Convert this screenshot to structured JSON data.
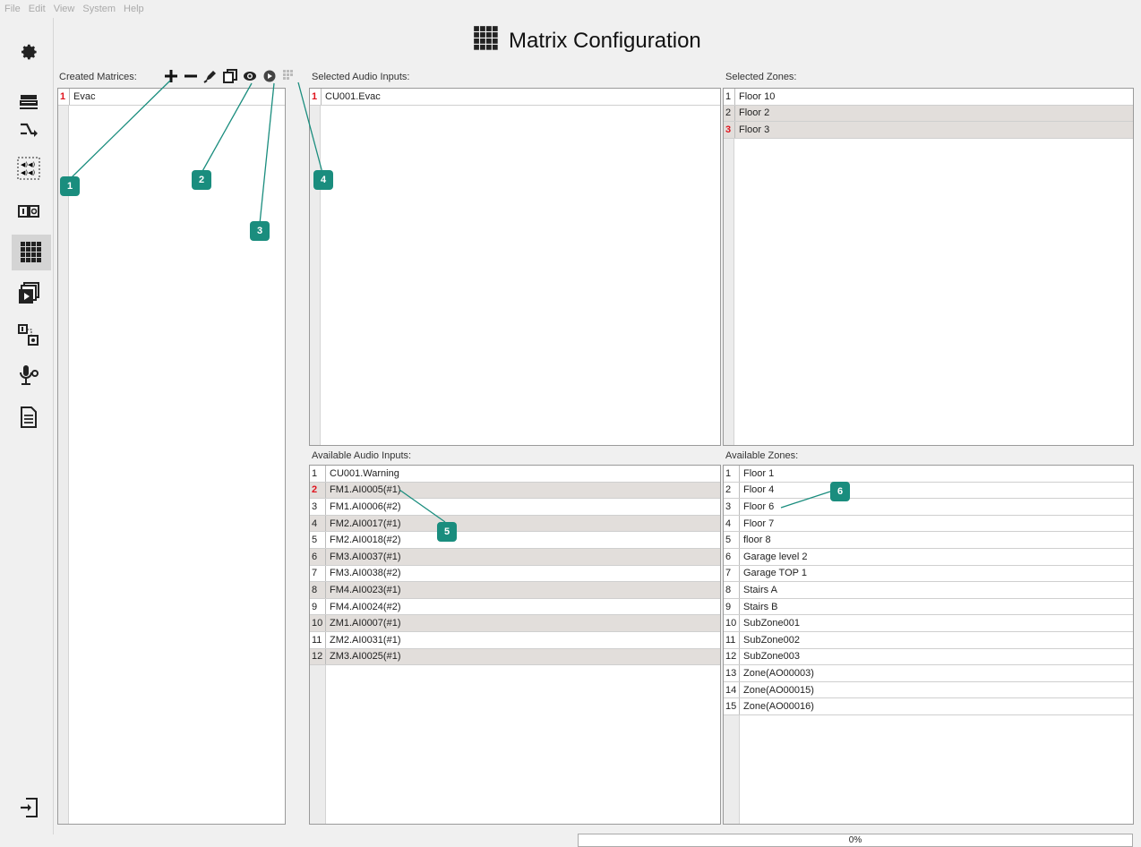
{
  "menu": [
    "File",
    "Edit",
    "View",
    "System",
    "Help"
  ],
  "rail": [
    {
      "name": "settings-gear-icon",
      "glyph": "✿"
    },
    {
      "name": "server-rack-icon"
    },
    {
      "name": "routing-arrow-icon"
    },
    {
      "name": "speaker-group-icon"
    },
    {
      "name": "io-icon"
    },
    {
      "name": "matrix-grid-icon"
    },
    {
      "name": "message-playback-icon"
    },
    {
      "name": "io-link-icon"
    },
    {
      "name": "call-station-icon"
    },
    {
      "name": "document-icon"
    },
    {
      "name": "logout-icon"
    }
  ],
  "title": "Matrix Configuration",
  "created_matrices": {
    "label": "Created Matrices:",
    "items": [
      {
        "n": "1",
        "text": "Evac",
        "red": true
      }
    ]
  },
  "toolbar": {
    "add": "+",
    "remove": "−",
    "edit": "✎",
    "copy": "⎘",
    "view": "◉",
    "play": "▶",
    "matrix": "⠿"
  },
  "selected_audio_inputs": {
    "label": "Selected Audio Inputs:",
    "items": [
      {
        "n": "1",
        "text": "CU001.Evac",
        "red": true
      }
    ]
  },
  "selected_zones": {
    "label": "Selected Zones:",
    "items": [
      {
        "n": "1",
        "text": "Floor 10",
        "red": false,
        "alt": false
      },
      {
        "n": "2",
        "text": "Floor 2",
        "red": false,
        "alt": true
      },
      {
        "n": "3",
        "text": "Floor 3",
        "red": true,
        "alt": true
      }
    ]
  },
  "available_audio_inputs": {
    "label": "Available Audio Inputs:",
    "items": [
      {
        "n": "1",
        "text": "CU001.Warning",
        "red": false,
        "alt": false
      },
      {
        "n": "2",
        "text": "FM1.AI0005(#1)",
        "red": true,
        "alt": true
      },
      {
        "n": "3",
        "text": "FM1.AI0006(#2)",
        "red": false,
        "alt": false
      },
      {
        "n": "4",
        "text": "FM2.AI0017(#1)",
        "red": false,
        "alt": true
      },
      {
        "n": "5",
        "text": "FM2.AI0018(#2)",
        "red": false,
        "alt": false
      },
      {
        "n": "6",
        "text": "FM3.AI0037(#1)",
        "red": false,
        "alt": true
      },
      {
        "n": "7",
        "text": "FM3.AI0038(#2)",
        "red": false,
        "alt": false
      },
      {
        "n": "8",
        "text": "FM4.AI0023(#1)",
        "red": false,
        "alt": true
      },
      {
        "n": "9",
        "text": "FM4.AI0024(#2)",
        "red": false,
        "alt": false
      },
      {
        "n": "10",
        "text": "ZM1.AI0007(#1)",
        "red": false,
        "alt": true
      },
      {
        "n": "11",
        "text": "ZM2.AI0031(#1)",
        "red": false,
        "alt": false
      },
      {
        "n": "12",
        "text": "ZM3.AI0025(#1)",
        "red": false,
        "alt": true
      }
    ]
  },
  "available_zones": {
    "label": "Available Zones:",
    "items": [
      {
        "n": "1",
        "text": "Floor 1"
      },
      {
        "n": "2",
        "text": "Floor 4"
      },
      {
        "n": "3",
        "text": "Floor 6"
      },
      {
        "n": "4",
        "text": "Floor 7"
      },
      {
        "n": "5",
        "text": "floor 8"
      },
      {
        "n": "6",
        "text": "Garage level 2"
      },
      {
        "n": "7",
        "text": "Garage TOP 1"
      },
      {
        "n": "8",
        "text": "Stairs A"
      },
      {
        "n": "9",
        "text": "Stairs B"
      },
      {
        "n": "10",
        "text": "SubZone001"
      },
      {
        "n": "11",
        "text": "SubZone002"
      },
      {
        "n": "12",
        "text": "SubZone003"
      },
      {
        "n": "13",
        "text": "Zone(AO00003)"
      },
      {
        "n": "14",
        "text": "Zone(AO00015)"
      },
      {
        "n": "15",
        "text": "Zone(AO00016)"
      }
    ]
  },
  "callouts": [
    "1",
    "2",
    "3",
    "4",
    "5",
    "6"
  ],
  "progress": {
    "value": "0%",
    "fraction": 0
  },
  "colors": {
    "callout": "#1a8d7e",
    "accent_red": "#e0141e",
    "alt_row": "#e2dedb"
  }
}
